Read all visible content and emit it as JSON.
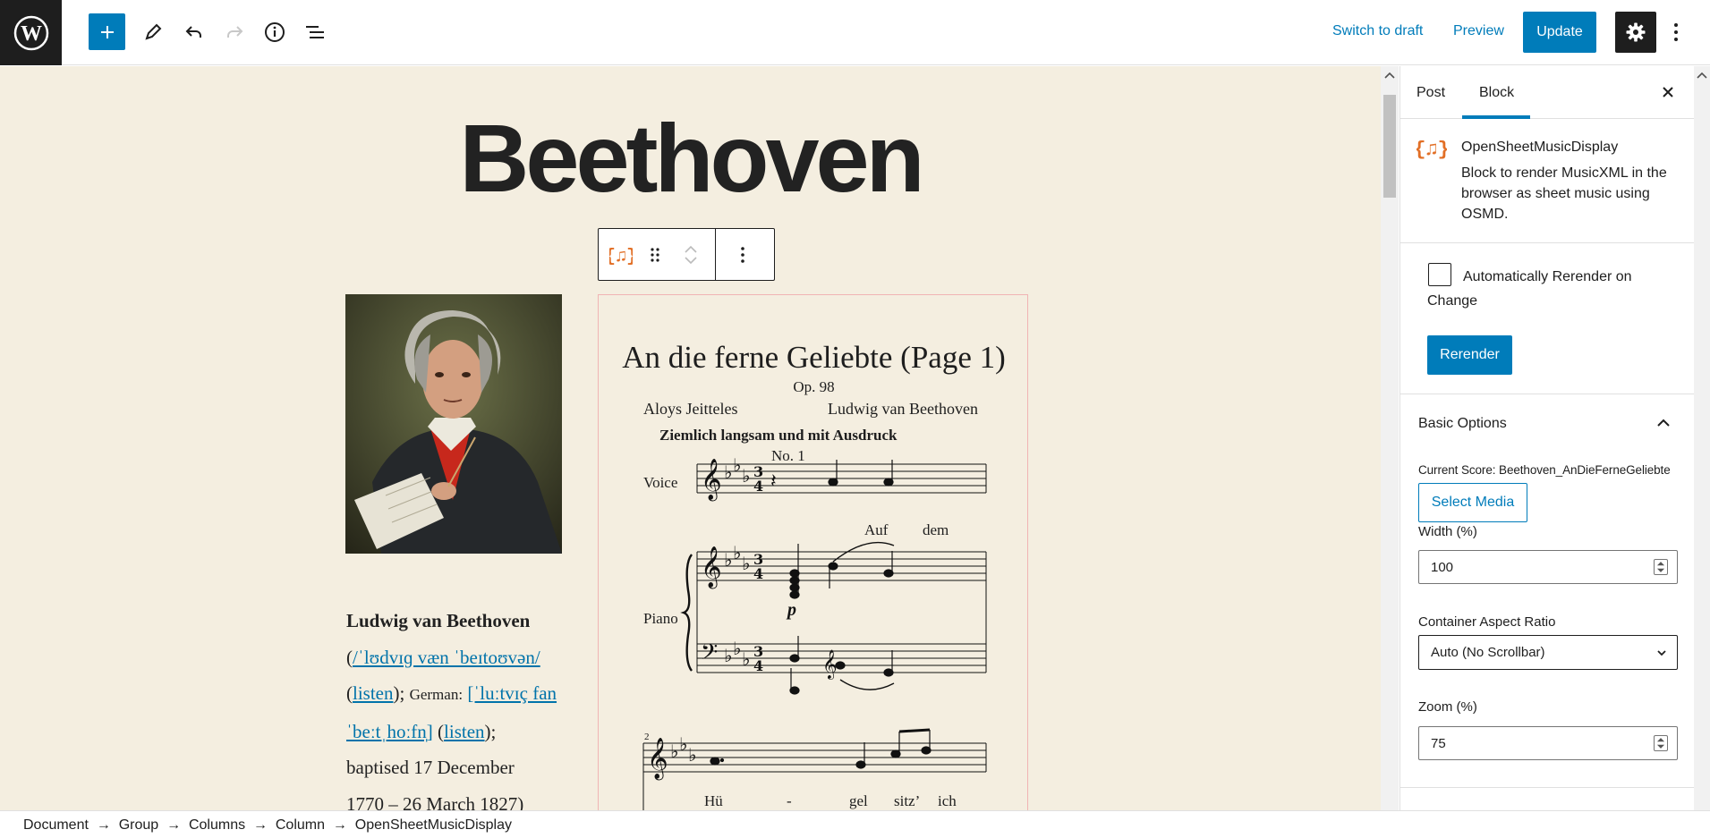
{
  "toolbar": {
    "switch_draft": "Switch to draft",
    "preview": "Preview",
    "update": "Update"
  },
  "post": {
    "title": "Beethoven"
  },
  "bio": {
    "name": "Ludwig van Beethoven",
    "ipa_en": "/ˈlʊdvɪɡ væn ˈbeɪtoʊvən/",
    "listen1": "listen",
    "german_prefix": "German:",
    "ipa_de": "[ˈluːtvɪç fan ˈbeːtˌhoːfn̩]",
    "listen2": "listen",
    "dates_line1": "baptised 17 December",
    "dates_line2": "1770 – 26 March 1827)"
  },
  "score": {
    "title": "An die ferne Geliebte (Page 1)",
    "opus": "Op. 98",
    "lyricist": "Aloys Jeitteles",
    "composer": "Ludwig van Beethoven",
    "tempo": "Ziemlich langsam und mit Ausdruck",
    "number": "No. 1",
    "part_voice": "Voice",
    "part_piano": "Piano",
    "dynamic": "p",
    "measure_number": "2",
    "lyrics_line1": [
      "Auf",
      "dem"
    ],
    "lyrics_line2": [
      "Hü",
      "-",
      "gel",
      "sitz’",
      "ich"
    ]
  },
  "sidebar": {
    "tab_post": "Post",
    "tab_block": "Block",
    "block_name": "OpenSheetMusicDisplay",
    "block_desc": "Block to render MusicXML in the browser as sheet music using OSMD.",
    "auto_rerender_label": "Automatically Rerender on Change",
    "rerender": "Rerender",
    "basic_options": "Basic Options",
    "current_score": "Current Score: Beethoven_AnDieFerneGeliebte",
    "select_media": "Select Media",
    "width_label": "Width (%)",
    "width_value": "100",
    "aspect_label": "Container Aspect Ratio",
    "aspect_value": "Auto (No Scrollbar)",
    "zoom_label": "Zoom (%)",
    "zoom_value": "75"
  },
  "breadcrumb": [
    "Document",
    "Group",
    "Columns",
    "Column",
    "OpenSheetMusicDisplay"
  ],
  "colors": {
    "accent": "#007cba",
    "canvas_bg": "#f4eee0",
    "block_icon": "#e26f26"
  }
}
